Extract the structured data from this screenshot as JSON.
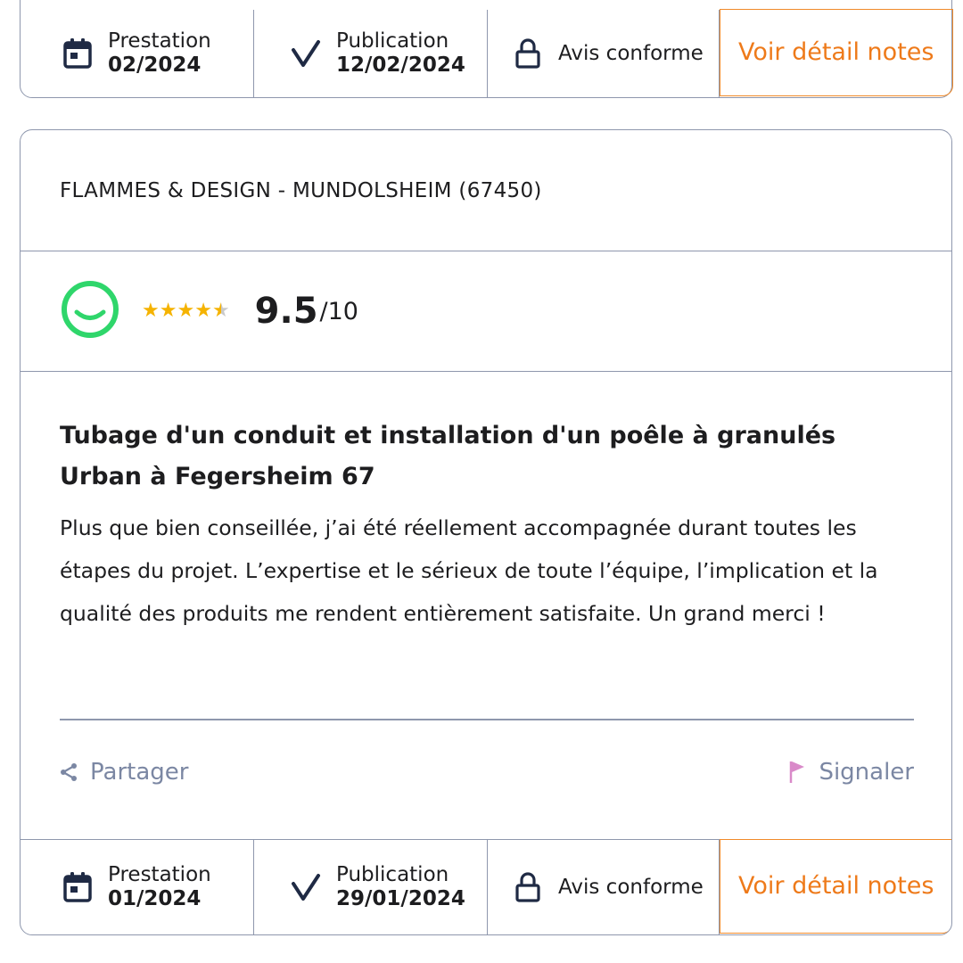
{
  "top_card": {
    "prestation_label": "Prestation",
    "prestation_value": "02/2024",
    "publication_label": "Publication",
    "publication_value": "12/02/2024",
    "avis_label": "Avis conforme",
    "voir_label": "Voir détail notes"
  },
  "review_card": {
    "company": "FLAMMES & DESIGN  - MUNDOLSHEIM (67450)",
    "rating": {
      "stars_value": 4.5,
      "stars_max": 5,
      "score": "9.5",
      "score_max": "/10"
    },
    "title": "Tubage d'un conduit et installation d'un poêle à granulés Urban à Fegersheim 67",
    "body": "Plus que bien conseillée, j’ai été réellement accompagnée durant toutes les étapes du projet. L’expertise et le sérieux de toute l’équipe, l’implication et la qualité des produits me rendent entièrement satisfaite. Un grand merci !",
    "share_label": "Partager",
    "report_label": "Signaler",
    "footer": {
      "prestation_label": "Prestation",
      "prestation_value": "01/2024",
      "publication_label": "Publication",
      "publication_value": "29/01/2024",
      "avis_label": "Avis conforme",
      "voir_label": "Voir détail notes"
    }
  },
  "colors": {
    "accent_orange": "#ee7a1a",
    "border": "#8e97ad",
    "smiley_green": "#2fd66b",
    "star_gold": "#f5b301",
    "action_gray": "#7b87a3",
    "flag_pink": "#d98ac9"
  },
  "icons": [
    "calendar-icon",
    "check-icon",
    "lock-icon",
    "smiley-icon",
    "share-icon",
    "flag-icon"
  ]
}
